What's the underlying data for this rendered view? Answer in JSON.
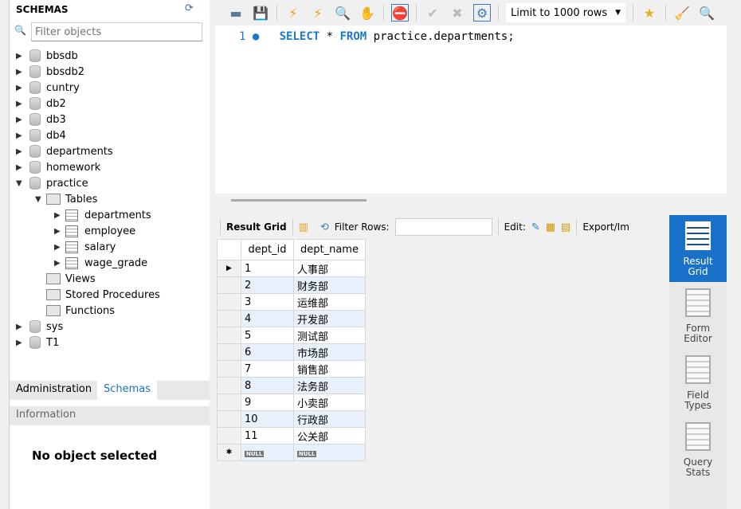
{
  "navigator": {
    "title": "SCHEMAS",
    "filter_placeholder": "Filter objects",
    "schemas": [
      "bbsdb",
      "bbsdb2",
      "cuntry",
      "db2",
      "db3",
      "db4",
      "departments",
      "homework",
      "practice",
      "sys",
      "T1"
    ],
    "practice": {
      "tables_label": "Tables",
      "tables": [
        "departments",
        "employee",
        "salary",
        "wage_grade"
      ],
      "views": "Views",
      "procs": "Stored Procedures",
      "functions": "Functions"
    }
  },
  "tabs": {
    "admin": "Administration",
    "schemas": "Schemas"
  },
  "info": {
    "header": "Information",
    "empty": "No object selected"
  },
  "toolbar": {
    "limit": "Limit to 1000 rows"
  },
  "editor": {
    "line": "1",
    "kw1": "SELECT",
    "star": "*",
    "kw2": "FROM",
    "rest": "practice.departments;"
  },
  "result": {
    "grid_label": "Result Grid",
    "filter_label": "Filter Rows:",
    "edit_label": "Edit:",
    "export_label": "Export/Im",
    "columns": [
      "dept_id",
      "dept_name"
    ],
    "rows": [
      [
        "1",
        "人事部"
      ],
      [
        "2",
        "财务部"
      ],
      [
        "3",
        "运维部"
      ],
      [
        "4",
        "开发部"
      ],
      [
        "5",
        "测试部"
      ],
      [
        "6",
        "市场部"
      ],
      [
        "7",
        "销售部"
      ],
      [
        "8",
        "法务部"
      ],
      [
        "9",
        "小卖部"
      ],
      [
        "10",
        "行政部"
      ],
      [
        "11",
        "公关部"
      ]
    ],
    "null": "NULL"
  },
  "side": [
    {
      "label": "Result\nGrid"
    },
    {
      "label": "Form\nEditor"
    },
    {
      "label": "Field\nTypes"
    },
    {
      "label": "Query\nStats"
    }
  ]
}
